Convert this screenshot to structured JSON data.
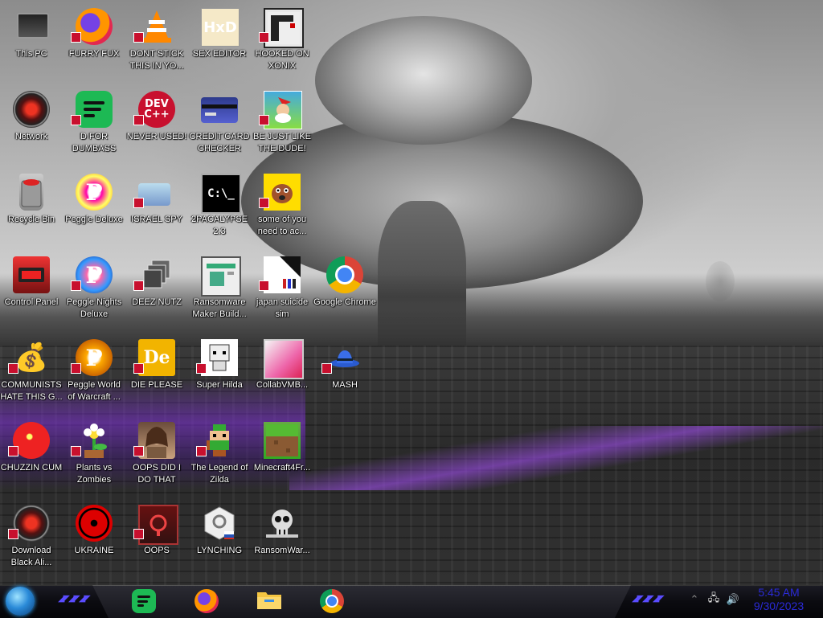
{
  "desktop": {
    "icons": [
      {
        "id": "this-pc",
        "label": "This PC",
        "icon": "computer-icon"
      },
      {
        "id": "furry-fux",
        "label": "FURRY FUX",
        "icon": "firefox-icon"
      },
      {
        "id": "dont-stick",
        "label": "DONT STICK THIS IN YO...",
        "icon": "vlc-cone-icon"
      },
      {
        "id": "sex-editor",
        "label": "SEX EDITOR",
        "icon": "hxd-icon",
        "glyph": "HxD"
      },
      {
        "id": "hooked-on-xonix",
        "label": "HOOKED ON XONIX",
        "icon": "xonix-icon"
      },
      {
        "id": "network",
        "label": "Network",
        "icon": "network-icon"
      },
      {
        "id": "d-for-dumbass",
        "label": "D FOR DUMBASS",
        "icon": "spotify-icon"
      },
      {
        "id": "never-used",
        "label": "NEVER USED!",
        "icon": "devcpp-icon",
        "glyph": "DEV C++"
      },
      {
        "id": "credit-card-checker",
        "label": "CREDIT CARD CHECKER",
        "icon": "credit-card-icon"
      },
      {
        "id": "be-just-like",
        "label": "BE JUST LIKE THE DUDE!",
        "icon": "elf-icon"
      },
      {
        "id": "recycle-bin",
        "label": "Recycle Bin",
        "icon": "recycle-bin-icon"
      },
      {
        "id": "peggle-deluxe",
        "label": "Peggle Deluxe",
        "icon": "peggle-icon",
        "glyph": "P"
      },
      {
        "id": "israel-spy",
        "label": "ISRAEL SPY",
        "icon": "spy-icon"
      },
      {
        "id": "2pacalypse",
        "label": "2PACALYPSE 2.3",
        "icon": "command-prompt-icon",
        "glyph": "C:\\_"
      },
      {
        "id": "some-of-you",
        "label": "some of you need to ac...",
        "icon": "dog-icon"
      },
      {
        "id": "control-panel",
        "label": "Control Panel",
        "icon": "control-panel-icon"
      },
      {
        "id": "peggle-nights",
        "label": "Peggle Nights Deluxe",
        "icon": "peggle-nights-icon",
        "glyph": "P"
      },
      {
        "id": "deez-nutz",
        "label": "DEEZ NUTZ",
        "icon": "windows-stack-icon"
      },
      {
        "id": "ransomware-maker",
        "label": "Ransomware Maker Build...",
        "icon": "window-app-icon"
      },
      {
        "id": "japan-suicide-sim",
        "label": "japan suicide sim",
        "icon": "japan-icon"
      },
      {
        "id": "google-chrome",
        "label": "Google Chrome",
        "icon": "chrome-icon"
      },
      {
        "id": "communists",
        "label": "COMMUNISTS HATE THIS G...",
        "icon": "money-bag-icon",
        "glyph": "💰"
      },
      {
        "id": "peggle-world",
        "label": "Peggle World of Warcraft ...",
        "icon": "peggle-wow-icon",
        "glyph": "P"
      },
      {
        "id": "die-please",
        "label": "DIE PLEASE",
        "icon": "de-icon",
        "glyph": "De"
      },
      {
        "id": "super-hilda",
        "label": "Super Hilda",
        "icon": "pixel-character-icon"
      },
      {
        "id": "collabvmb",
        "label": "CollabVMB...",
        "icon": "collabvm-icon"
      },
      {
        "id": "mash",
        "label": "MASH",
        "icon": "hat-icon"
      },
      {
        "id": "chuzzin-cum",
        "label": "CHUZZIN CUM",
        "icon": "chuzzle-icon"
      },
      {
        "id": "plants-vs-zombies",
        "label": "Plants vs Zombies",
        "icon": "flower-icon"
      },
      {
        "id": "oops-did-i",
        "label": "OOPS DID I DO THAT",
        "icon": "portrait-icon"
      },
      {
        "id": "legend-of-zilda",
        "label": "The Legend of Zilda",
        "icon": "zelda-icon"
      },
      {
        "id": "minecraft4fr",
        "label": "Minecraft4Fr...",
        "icon": "minecraft-icon"
      },
      {
        "id": "download-black",
        "label": "Download Black Ali...",
        "icon": "network-red-icon"
      },
      {
        "id": "ukraine",
        "label": "UKRAINE",
        "icon": "radiation-icon"
      },
      {
        "id": "oops",
        "label": "OOPS",
        "icon": "oops-icon"
      },
      {
        "id": "lynching",
        "label": "LYNCHING",
        "icon": "lynching-icon"
      },
      {
        "id": "ransomwar",
        "label": "RansomWar...",
        "icon": "skull-icon"
      }
    ]
  },
  "taskbar": {
    "start_button": "start-orb-icon",
    "pinned": [
      {
        "name": "spotify",
        "icon": "spotify-icon"
      },
      {
        "name": "firefox",
        "icon": "firefox-icon"
      },
      {
        "name": "file-explorer",
        "icon": "folder-icon"
      },
      {
        "name": "chrome",
        "icon": "chrome-icon"
      }
    ],
    "tray": [
      {
        "name": "show-hidden",
        "icon": "chevron-up-icon",
        "glyph": "⌃"
      },
      {
        "name": "network",
        "icon": "network-tray-icon",
        "glyph": "🖧"
      },
      {
        "name": "volume",
        "icon": "speaker-icon",
        "glyph": "🔊"
      }
    ],
    "clock": {
      "time": "5:45 AM",
      "date": "9/30/2023"
    }
  },
  "colors": {
    "clock_text": "#2a2ad8",
    "accent_purple": "#9b3cff",
    "badge_red": "#c8102e"
  }
}
